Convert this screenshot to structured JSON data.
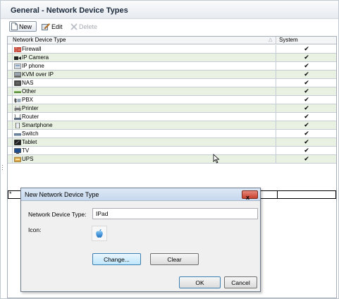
{
  "panel": {
    "title": "General - Network Device Types"
  },
  "toolbar": {
    "new_label": "New",
    "edit_label": "Edit",
    "delete_label": "Delete"
  },
  "grid": {
    "columns": [
      "Network Device Type",
      "System"
    ],
    "sort_indicator": "△",
    "rows": [
      {
        "label": "Firewall",
        "icon": "firewall-icon",
        "system": "✔"
      },
      {
        "label": "IP Camera",
        "icon": "camera-icon",
        "system": "✔"
      },
      {
        "label": "IP phone",
        "icon": "phone-icon",
        "system": "✔"
      },
      {
        "label": "KVM over IP",
        "icon": "kvm-icon",
        "system": "✔"
      },
      {
        "label": "NAS",
        "icon": "nas-icon",
        "system": "✔"
      },
      {
        "label": "Other",
        "icon": "other-icon",
        "system": "✔"
      },
      {
        "label": "PBX",
        "icon": "pbx-icon",
        "system": "✔"
      },
      {
        "label": "Printer",
        "icon": "printer-icon",
        "system": "✔"
      },
      {
        "label": "Router",
        "icon": "router-icon",
        "system": "✔"
      },
      {
        "label": "Smartphone",
        "icon": "smartphone-icon",
        "system": "✔"
      },
      {
        "label": "Switch",
        "icon": "switch-icon",
        "system": "✔"
      },
      {
        "label": "Tablet",
        "icon": "tablet-icon",
        "system": "✔"
      },
      {
        "label": "TV",
        "icon": "tv-icon",
        "system": "✔"
      },
      {
        "label": "UPS",
        "icon": "ups-icon",
        "system": "✔"
      }
    ],
    "new_row_marker": "*"
  },
  "dialog": {
    "title": "New Network Device Type",
    "close_label": "x",
    "type_label": "Network Device Type:",
    "type_value": "IPad",
    "icon_label": "Icon:",
    "icon_name": "apple-icon",
    "change_label": "Change...",
    "clear_label": "Clear",
    "ok_label": "OK",
    "cancel_label": "Cancel"
  },
  "colors": {
    "row_alt": "#e9f2e2",
    "accent": "#3c7fb1",
    "close_button": "#c7402d"
  }
}
